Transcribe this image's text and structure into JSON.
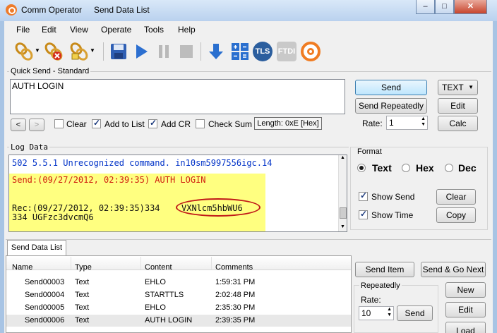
{
  "window": {
    "app_title": "Comm Operator",
    "doc_title": "Send Data List",
    "min": "–",
    "max": "□",
    "close": "✕"
  },
  "menu": [
    "File",
    "Edit",
    "View",
    "Operate",
    "Tools",
    "Help"
  ],
  "toolbar": {
    "tls_label": "TLS",
    "ftdi_label": "FTDI"
  },
  "quick_send": {
    "group_label": "Quick Send - Standard",
    "text": "AUTH LOGIN",
    "send": "Send",
    "send_repeatedly": "Send Repeatedly",
    "rate_label": "Rate:",
    "rate_value": "1",
    "format_value": "TEXT",
    "edit": "Edit",
    "calc": "Calc",
    "nav_prev": "<",
    "nav_next": ">",
    "clear_label": "Clear",
    "add_to_list_label": "Add to List",
    "add_cr_label": "Add CR",
    "check_sum_label": "Check Sum",
    "length_text": "Length: 0xE [Hex]",
    "clear_checked": false,
    "add_to_list_checked": true,
    "add_cr_checked": true,
    "check_sum_checked": false
  },
  "log": {
    "group_label": "Log Data",
    "line1": "502 5.5.1 Unrecognized command. in10sm5997556igc.14",
    "line2": "Send:(09/27/2012, 02:39:35) AUTH LOGIN",
    "line3a": "Rec:(09/27/2012, 02:39:35)334 ",
    "line3b": "VXNlcm5hbWU6",
    "line4": "334 UGFzc3dvcmQ6",
    "colors": {
      "recv_blue": "#0032c8",
      "send_red": "#d02010",
      "highlight": "#ffff80",
      "circle": "#c01818"
    }
  },
  "format": {
    "group_label": "Format",
    "options": [
      "Text",
      "Hex",
      "Dec"
    ],
    "selected": "Text",
    "show_send_label": "Show Send",
    "show_time_label": "Show Time",
    "clear": "Clear",
    "copy": "Copy"
  },
  "send_list": {
    "tab": "Send Data List",
    "columns": [
      "Name",
      "Type",
      "Content",
      "Comments"
    ],
    "rows": [
      {
        "name": "Send00003",
        "type": "Text",
        "content": "EHLO",
        "comments": "1:59:31 PM"
      },
      {
        "name": "Send00004",
        "type": "Text",
        "content": "STARTTLS",
        "comments": "2:02:48 PM"
      },
      {
        "name": "Send00005",
        "type": "Text",
        "content": "EHLO",
        "comments": "2:35:30 PM"
      },
      {
        "name": "Send00006",
        "type": "Text",
        "content": "AUTH LOGIN",
        "comments": "2:39:35 PM"
      }
    ],
    "send_item": "Send Item",
    "send_go_next": "Send & Go Next",
    "repeatedly_label": "Repeatedly",
    "rate_label": "Rate:",
    "rate_value": "10",
    "send": "Send",
    "new": "New",
    "edit": "Edit",
    "load": "Load"
  }
}
